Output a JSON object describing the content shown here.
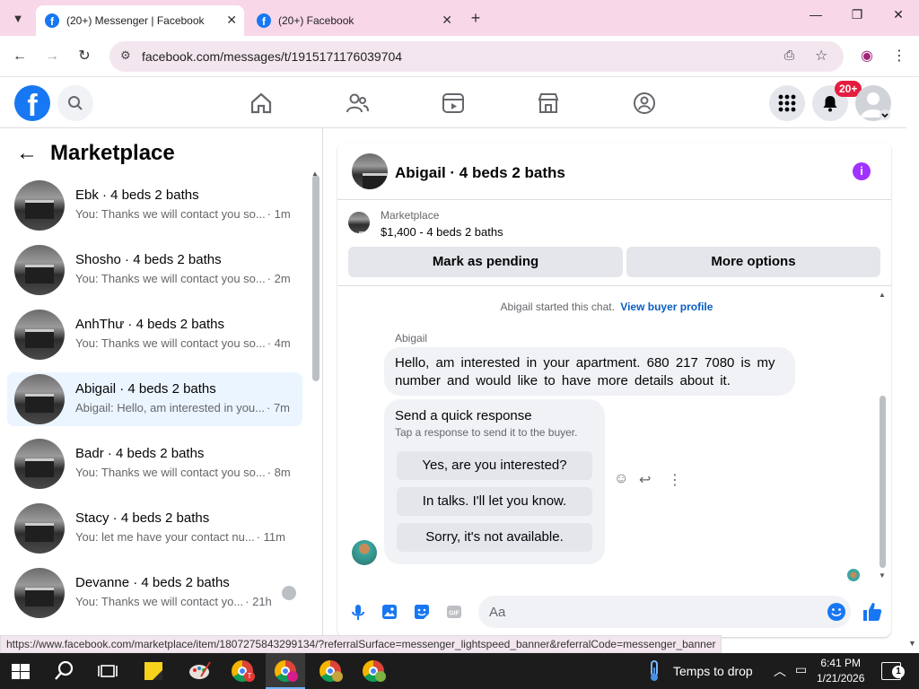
{
  "browser": {
    "tabs": [
      {
        "title": "(20+) Messenger | Facebook",
        "active": true
      },
      {
        "title": "(20+) Facebook",
        "active": false
      }
    ],
    "url": "facebook.com/messages/t/1915171176039704",
    "status_url": "https://www.facebook.com/marketplace/item/1807275843299134/?referralSurface=messenger_lightspeed_banner&referralCode=messenger_banner"
  },
  "fb": {
    "logo": "f",
    "notifications_badge": "20+"
  },
  "sidebar": {
    "title": "Marketplace",
    "conversations": [
      {
        "name": "Ebk · 4 beds 2 baths",
        "preview": "You: Thanks we will contact you so...",
        "time": "· 1m"
      },
      {
        "name": "Shosho · 4 beds 2 baths",
        "preview": "You: Thanks we will contact you so...",
        "time": "· 2m"
      },
      {
        "name": "AnhThư · 4 beds 2 baths",
        "preview": "You: Thanks we will contact you so...",
        "time": "· 4m"
      },
      {
        "name": "Abigail · 4 beds 2 baths",
        "preview": "Abigail: Hello, am interested in you...",
        "time": "· 7m"
      },
      {
        "name": "Badr · 4 beds 2 baths",
        "preview": "You: Thanks we will contact you so...",
        "time": "· 8m"
      },
      {
        "name": "Stacy · 4 beds 2 baths",
        "preview": "You: let me have your contact nu...",
        "time": "· 11m"
      },
      {
        "name": "Devanne · 4 beds 2 baths",
        "preview": "You: Thanks we will contact yo...",
        "time": "· 21h"
      }
    ]
  },
  "chat": {
    "title": "Abigail · 4 beds 2 baths",
    "listing_label": "Marketplace",
    "listing_detail": "$1,400 - 4 beds 2 baths",
    "mark_pending": "Mark as pending",
    "more_options": "More options",
    "started_text": "Abigail started this chat.",
    "buyer_profile_link": "View buyer profile",
    "sender": "Abigail",
    "message": "Hello,  am interested  in your  apartment.  680 217 7080  is my number  and would like  to have more  details  about  it.",
    "quick_title": "Send a quick response",
    "quick_subtitle": "Tap a response to send it to the buyer.",
    "quick_responses": [
      "Yes, are you interested?",
      "In talks. I'll let you know.",
      "Sorry, it's not available."
    ],
    "input_placeholder": "Aa"
  },
  "taskbar": {
    "weather": "Temps to drop",
    "time": "6:41 PM",
    "date": "1/21/2026",
    "notification_count": "1"
  },
  "colors": {
    "brand": "#1877f2",
    "tabbar": "#f8d7e8",
    "selected_conv": "#ebf5ff",
    "info_purple": "#a033ff"
  }
}
